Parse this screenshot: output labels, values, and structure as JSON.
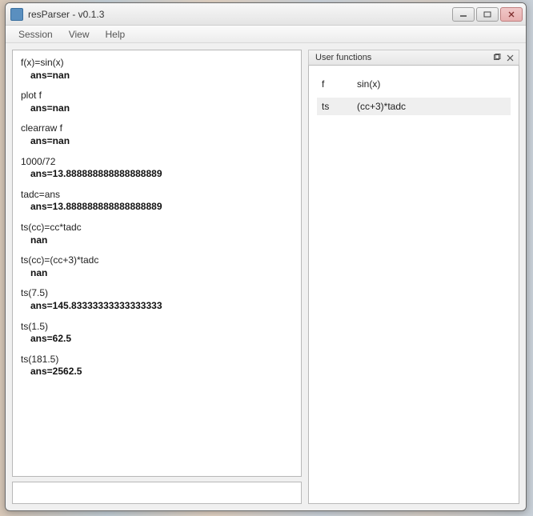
{
  "window": {
    "title": "resParser - v0.1.3"
  },
  "menu": {
    "session": "Session",
    "view": "View",
    "help": "Help"
  },
  "console": {
    "entries": [
      {
        "cmd": "f(x)=sin(x)",
        "ans": "ans=nan"
      },
      {
        "cmd": "plot f",
        "ans": "ans=nan"
      },
      {
        "cmd": "clearraw f",
        "ans": "ans=nan"
      },
      {
        "cmd": "1000/72",
        "ans": "ans=13.888888888888888889"
      },
      {
        "cmd": "tadc=ans",
        "ans": "ans=13.888888888888888889"
      },
      {
        "cmd": "ts(cc)=cc*tadc",
        "ans": "nan"
      },
      {
        "cmd": "ts(cc)=(cc+3)*tadc",
        "ans": "nan"
      },
      {
        "cmd": "ts(7.5)",
        "ans": "ans=145.83333333333333333"
      },
      {
        "cmd": "ts(1.5)",
        "ans": "ans=62.5"
      },
      {
        "cmd": "ts(181.5)",
        "ans": "ans=2562.5"
      }
    ],
    "input_value": ""
  },
  "user_functions": {
    "title": "User functions",
    "items": [
      {
        "name": "f",
        "body": "sin(x)"
      },
      {
        "name": "ts",
        "body": "(cc+3)*tadc"
      }
    ]
  }
}
